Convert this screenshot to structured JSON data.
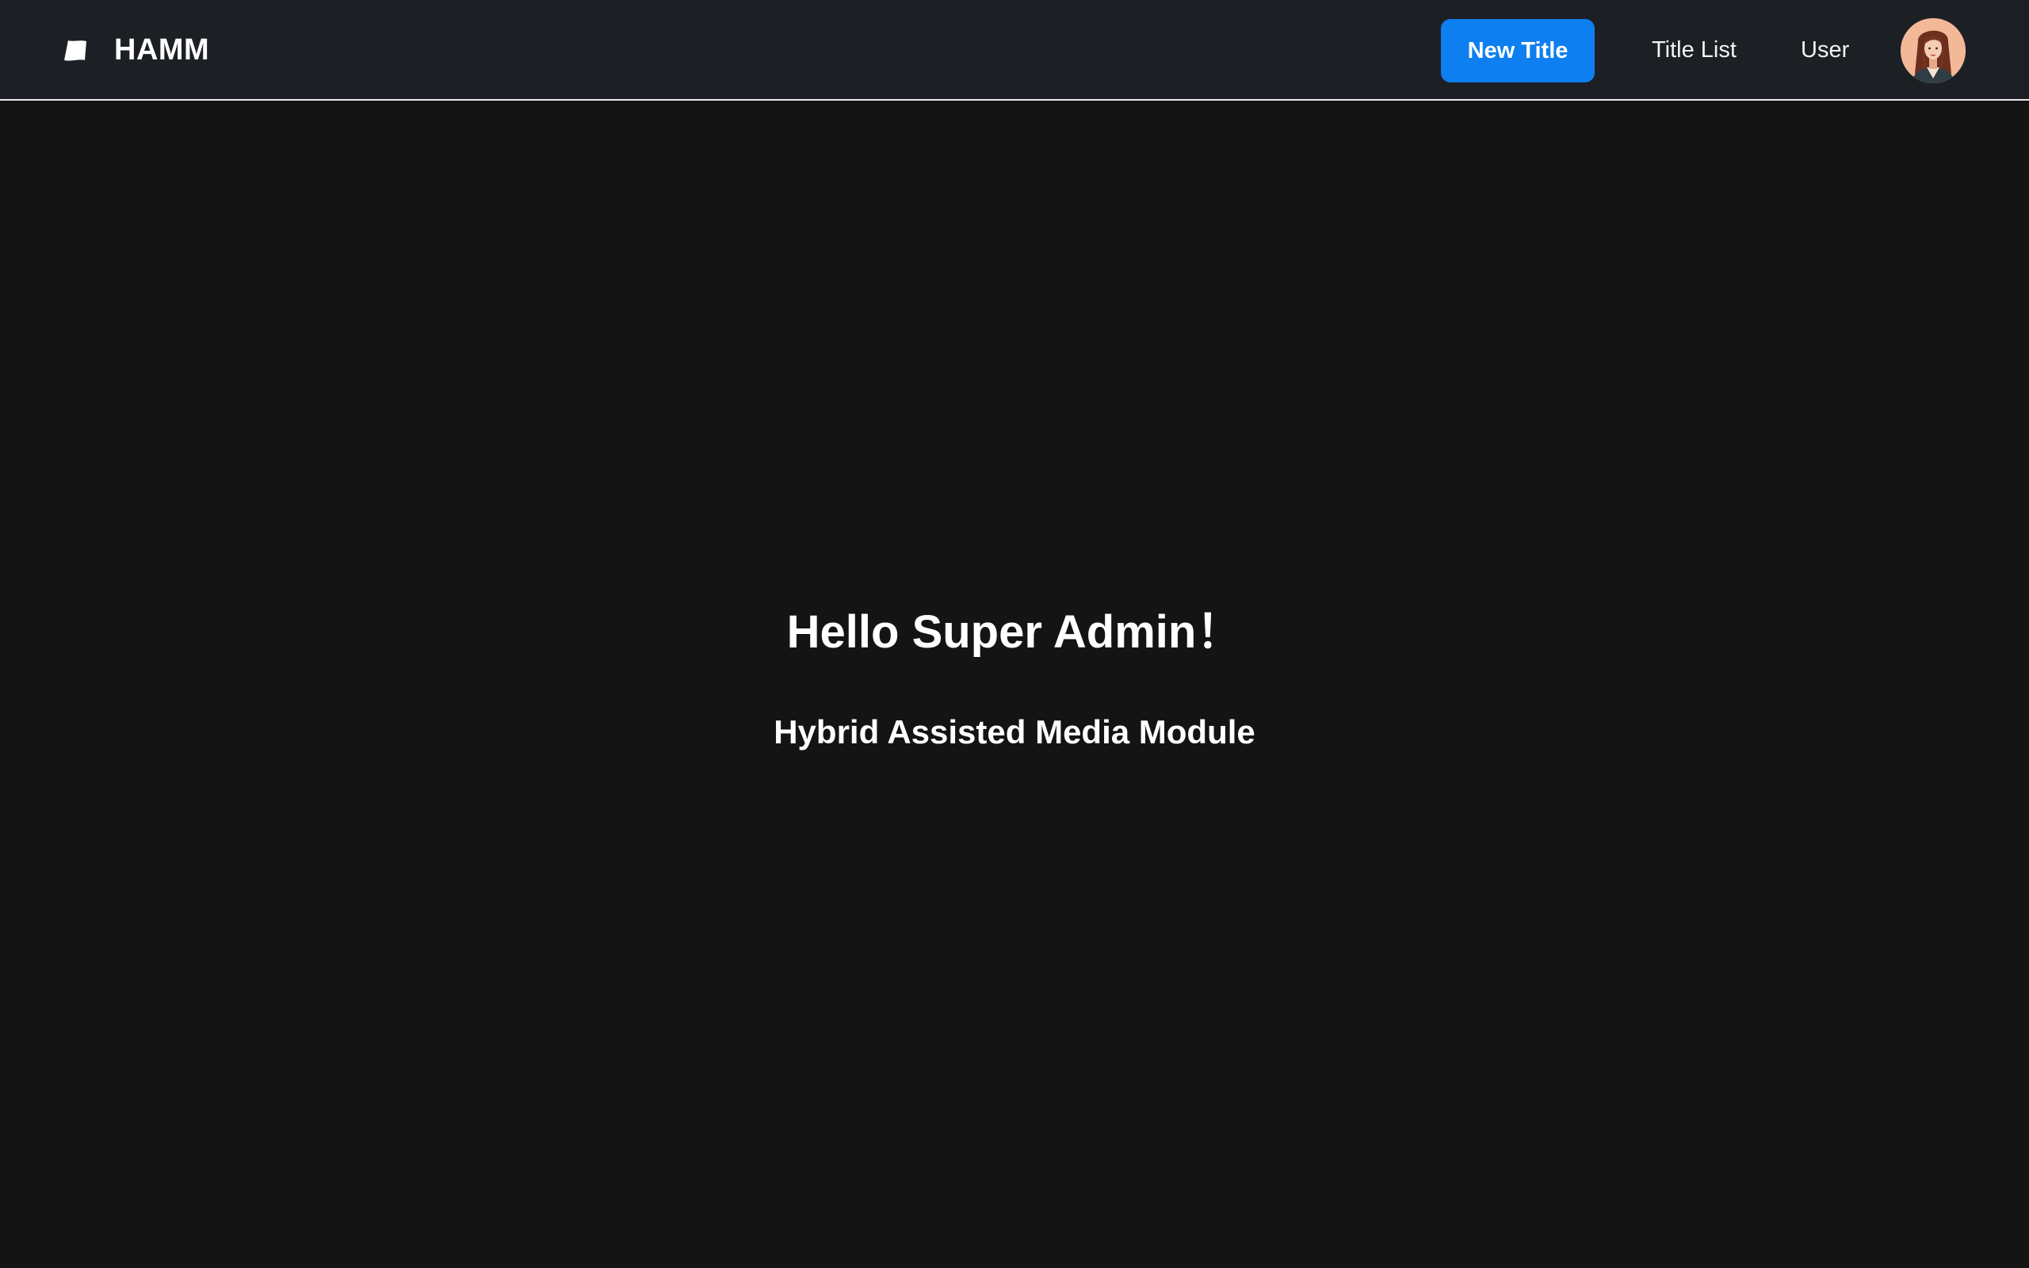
{
  "header": {
    "brand_name": "HAMM",
    "new_title_label": "New Title",
    "nav_items": [
      {
        "label": "Title List"
      },
      {
        "label": "User"
      }
    ],
    "avatar_icon": "user-avatar-icon"
  },
  "main": {
    "greeting": "Hello Super Admin！",
    "subtitle": "Hybrid Assisted Media Module"
  },
  "colors": {
    "header_bg": "#1c2025",
    "page_bg": "#141414",
    "accent": "#0d7ff0",
    "text": "#ffffff"
  }
}
